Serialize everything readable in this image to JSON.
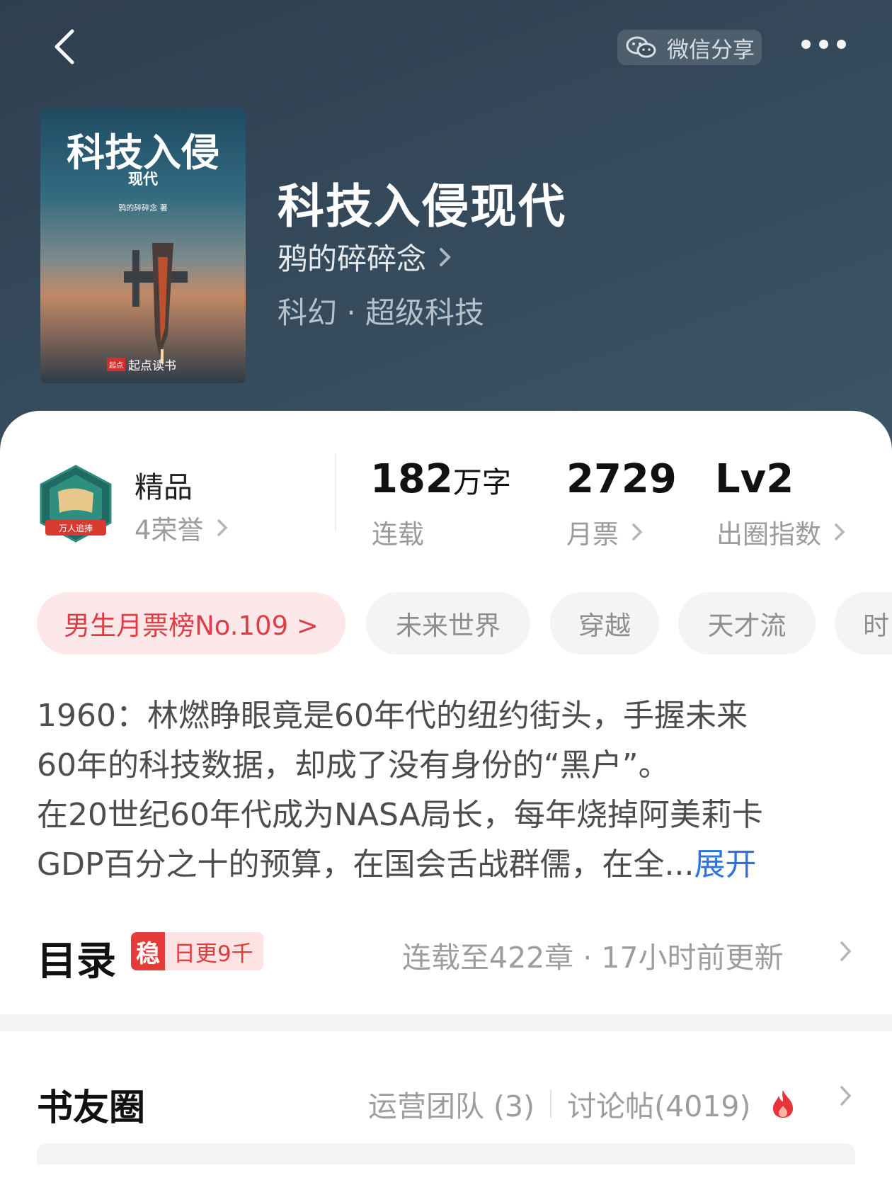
{
  "header": {
    "share_label": "微信分享"
  },
  "book": {
    "title": "科技入侵现代",
    "author": "鸦的碎碎念",
    "genre": "科幻 · 超级科技",
    "cover": {
      "big_title": "科技入侵",
      "sub_title": "现代",
      "author_line": "鸦的碎碎念 著",
      "publisher": "起点读书"
    }
  },
  "stats": {
    "quality": "精品",
    "honors": "4荣誉",
    "badge_text": "万人追捧",
    "words_num": "182",
    "words_unit": "万字",
    "words_label": "连载",
    "monthly_votes": "2729",
    "monthly_votes_label": "月票",
    "index_value": "Lv2",
    "index_label": "出圈指数"
  },
  "tags": [
    "男生月票榜No.109 >",
    "未来世界",
    "穿越",
    "天才流",
    "时"
  ],
  "description": {
    "lines": [
      "1960：林燃睁眼竟是60年代的纽约街头，手握未来",
      "60年的科技数据，却成了没有身份的“黑户”。",
      "在20世纪60年代成为NASA局长，每年烧掉阿美莉卡",
      "GDP百分之十的预算，在国会舌战群儒，在全..."
    ],
    "expand": "展开"
  },
  "toc": {
    "title": "目录",
    "stable_badge": "稳",
    "update_rate": "日更9千",
    "info": "连载至422章 · 17小时前更新"
  },
  "circle": {
    "title": "书友圈",
    "ops_team": "运营团队 (3)",
    "posts": "讨论帖(4019)"
  },
  "colors": {
    "hero_bg": "#34495a",
    "accent_red": "#de3d45",
    "link_blue": "#2d73e0"
  }
}
